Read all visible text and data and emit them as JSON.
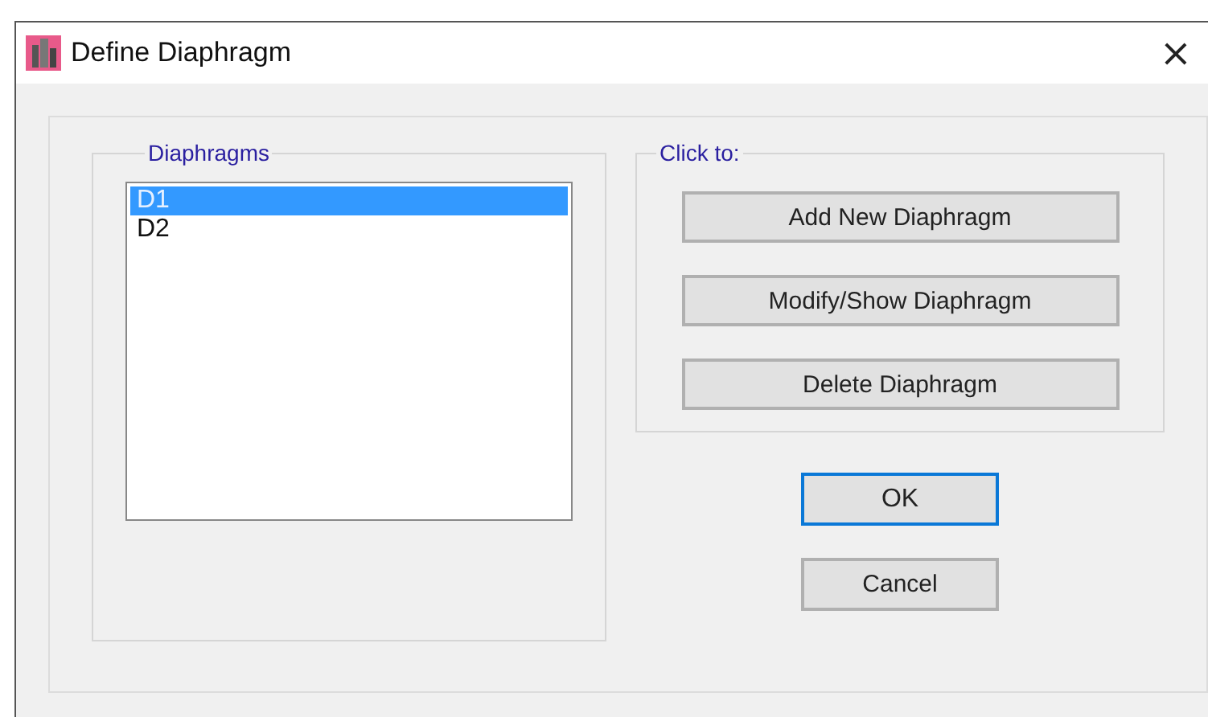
{
  "window": {
    "title": "Define Diaphragm",
    "close": "×"
  },
  "diaphragms": {
    "label": "Diaphragms",
    "items": [
      {
        "label": "D1",
        "selected": true
      },
      {
        "label": "D2",
        "selected": false
      }
    ]
  },
  "actions": {
    "label": "Click to:",
    "buttons": [
      "Add New Diaphragm",
      "Modify/Show Diaphragm",
      "Delete Diaphragm"
    ]
  },
  "dialog_buttons": [
    {
      "label": "OK",
      "default": true
    },
    {
      "label": "Cancel",
      "default": false
    }
  ]
}
